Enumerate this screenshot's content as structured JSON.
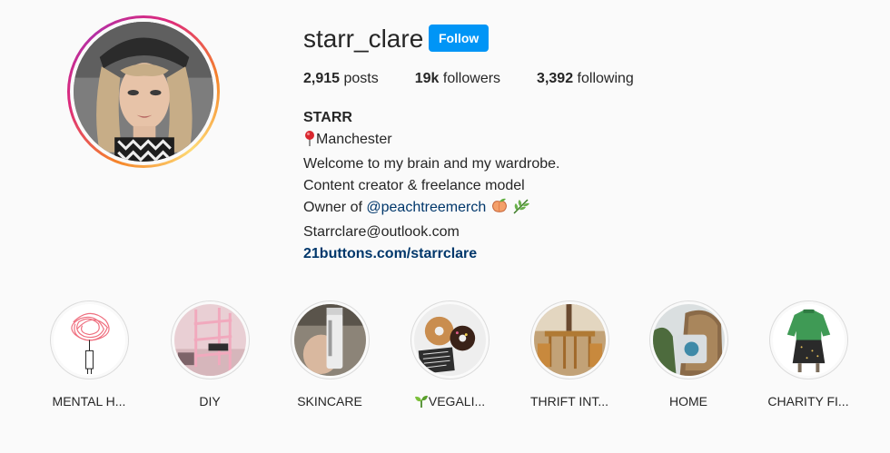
{
  "profile": {
    "username": "starr_clare",
    "follow_label": "Follow",
    "stats": {
      "posts_count": "2,915",
      "posts_label": "posts",
      "followers_count": "19k",
      "followers_label": "followers",
      "following_count": "3,392",
      "following_label": "following"
    }
  },
  "bio": {
    "name": "STARR",
    "location_icon": "round-pushpin-icon",
    "location": "Manchester",
    "line1": "Welcome to my brain and my wardrobe.",
    "line2": "Content creator & freelance model",
    "owner_prefix": "Owner of",
    "mention": "@peachtreemerch",
    "mention_icons": [
      "peach-icon",
      "herb-icon"
    ],
    "email": "Starrclare@outlook.com",
    "link": "21buttons.com/starrclare"
  },
  "highlights": [
    {
      "label": "MENTAL H...",
      "icon": "scribble-head-drawing"
    },
    {
      "label": "DIY",
      "icon": "pink-shelf-photo"
    },
    {
      "label": "SKINCARE",
      "icon": "skincare-bottle-photo"
    },
    {
      "label": "VEGALI...",
      "prefix_icon": "seedling-icon",
      "icon": "donuts-photo"
    },
    {
      "label": "THRIFT INT...",
      "icon": "rattan-furniture-photo"
    },
    {
      "label": "HOME",
      "icon": "chair-cushion-photo"
    },
    {
      "label": "CHARITY FI...",
      "icon": "green-top-outfit-photo"
    }
  ],
  "colors": {
    "follow_button": "#0095f6",
    "link": "#00376b",
    "text": "#262626",
    "background": "#fafafa"
  }
}
